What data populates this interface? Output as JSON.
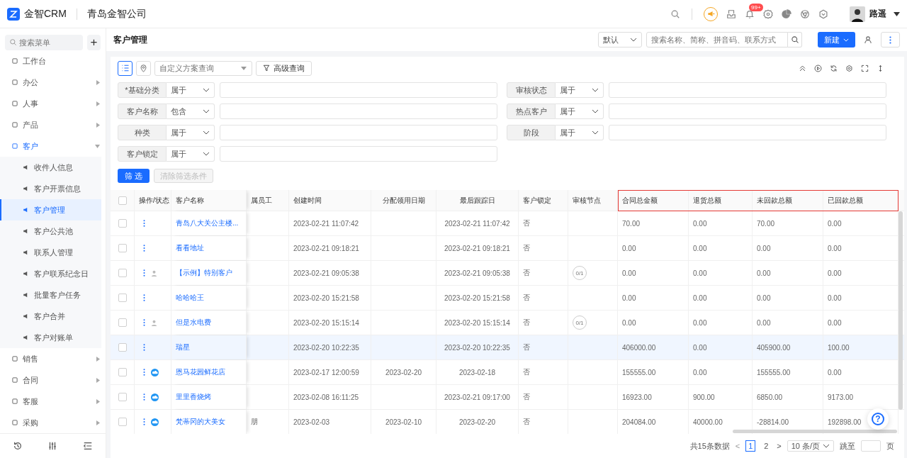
{
  "header": {
    "brand": "金智CRM",
    "company": "青岛金智公司",
    "badge": "99+",
    "user": "路遥"
  },
  "sidebar": {
    "search_placeholder": "搜索菜单",
    "add": "+",
    "items": [
      {
        "label": "工作台",
        "kind": "link",
        "selected": false
      },
      {
        "label": "办公",
        "kind": "group",
        "selected": false,
        "expanded": false
      },
      {
        "label": "人事",
        "kind": "group",
        "selected": false,
        "expanded": false
      },
      {
        "label": "产品",
        "kind": "group",
        "selected": false,
        "expanded": false
      },
      {
        "label": "客户",
        "kind": "group",
        "selected": true,
        "expanded": true,
        "children": [
          {
            "label": "收件人信息",
            "selected": false
          },
          {
            "label": "客户开票信息",
            "selected": false
          },
          {
            "label": "客户管理",
            "selected": true
          },
          {
            "label": "客户公共池",
            "selected": false
          },
          {
            "label": "联系人管理",
            "selected": false
          },
          {
            "label": "客户联系纪念日",
            "selected": false
          },
          {
            "label": "批量客户任务",
            "selected": false
          },
          {
            "label": "客户合并",
            "selected": false
          },
          {
            "label": "客户对账单",
            "selected": false
          }
        ]
      },
      {
        "label": "销售",
        "kind": "group",
        "selected": false,
        "expanded": false
      },
      {
        "label": "合同",
        "kind": "group",
        "selected": false,
        "expanded": false
      },
      {
        "label": "客服",
        "kind": "group",
        "selected": false,
        "expanded": false
      },
      {
        "label": "采购",
        "kind": "group",
        "selected": false,
        "expanded": false
      }
    ]
  },
  "page": {
    "title": "客户管理",
    "scope": "默认",
    "search_placeholder": "搜索名称、简称、拼音码、联系方式",
    "new_button": "新建"
  },
  "toolbar": {
    "scheme_placeholder": "自定义方案查询",
    "advanced": "高级查询",
    "list_view_selected": true
  },
  "filters": [
    {
      "label": "*基础分类",
      "op": "属于"
    },
    {
      "label": "审核状态",
      "op": "属于"
    },
    {
      "label": "客户名称",
      "op": "包含"
    },
    {
      "label": "热点客户",
      "op": "属于"
    },
    {
      "label": "种类",
      "op": "属于"
    },
    {
      "label": "阶段",
      "op": "属于"
    },
    {
      "label": "客户锁定",
      "op": "属于"
    }
  ],
  "filter_buttons": {
    "apply": "筛 选",
    "clear": "清除筛选条件",
    "clear_disabled": true
  },
  "table": {
    "select_all_checked": false,
    "columns": [
      {
        "label": "操作/状态",
        "highlighted": false
      },
      {
        "label": "客户名称",
        "highlighted": false
      },
      {
        "label": "属员工",
        "highlighted": false
      },
      {
        "label": "创建时间",
        "highlighted": false
      },
      {
        "label": "分配领用日期",
        "highlighted": false
      },
      {
        "label": "最后跟踪日",
        "highlighted": false
      },
      {
        "label": "客户锁定",
        "highlighted": false
      },
      {
        "label": "审核节点",
        "highlighted": false
      },
      {
        "label": "合同总金额",
        "highlighted": true
      },
      {
        "label": "退货总额",
        "highlighted": true
      },
      {
        "label": "未回款总额",
        "highlighted": true
      },
      {
        "label": "已回款总额",
        "highlighted": true
      }
    ],
    "rows": [
      {
        "checked": false,
        "highlighted": false,
        "kind": "plain",
        "cells": [
          "",
          "青岛八大关公主楼...",
          "",
          "2023-02-21 11:07:42",
          "",
          "2023-02-21 11:07:42",
          "否",
          "",
          "70.00",
          "0.00",
          "70.00",
          "0.00"
        ]
      },
      {
        "checked": false,
        "highlighted": false,
        "kind": "plain",
        "cells": [
          "",
          "看看地址",
          "",
          "2023-02-21 09:18:21",
          "",
          "2023-02-21 09:18:21",
          "否",
          "",
          "0.00",
          "0.00",
          "0.00",
          "0.00"
        ]
      },
      {
        "checked": false,
        "highlighted": false,
        "kind": "person",
        "cells": [
          "",
          "【示例】特别客户",
          "",
          "2023-02-21 09:05:38",
          "",
          "2023-02-21 09:05:38",
          "否",
          "0/1",
          "0.00",
          "0.00",
          "0.00",
          "0.00"
        ]
      },
      {
        "checked": false,
        "highlighted": false,
        "kind": "plain",
        "cells": [
          "",
          "哈哈哈王",
          "",
          "2023-02-20 15:21:58",
          "",
          "2023-02-20 15:21:58",
          "否",
          "",
          "0.00",
          "0.00",
          "0.00",
          "0.00"
        ]
      },
      {
        "checked": false,
        "highlighted": false,
        "kind": "person",
        "cells": [
          "",
          "但是水电费",
          "",
          "2023-02-20 15:15:14",
          "",
          "2023-02-20 15:15:14",
          "否",
          "0/1",
          "0.00",
          "0.00",
          "0.00",
          "0.00"
        ]
      },
      {
        "checked": false,
        "highlighted": true,
        "kind": "plain",
        "cells": [
          "",
          "瑞星",
          "",
          "2023-02-20 10:22:35",
          "",
          "2023-02-20 10:22:35",
          "否",
          "",
          "406000.00",
          "0.00",
          "405900.00",
          "100.00"
        ]
      },
      {
        "checked": false,
        "highlighted": false,
        "kind": "cloud",
        "cells": [
          "",
          "恩马花园鲜花店",
          "",
          "2023-02-17 12:00:59",
          "2023-02-20",
          "2023-02-18",
          "否",
          "",
          "155555.00",
          "0.00",
          "155555.00",
          "0.00"
        ]
      },
      {
        "checked": false,
        "highlighted": false,
        "kind": "cloud",
        "cells": [
          "",
          "里里香烧烤",
          "",
          "2023-02-08 16:11:25",
          "",
          "2023-02-21 09:17:00",
          "否",
          "",
          "16923.00",
          "900.00",
          "6850.00",
          "9173.00"
        ]
      },
      {
        "checked": false,
        "highlighted": false,
        "kind": "cloud",
        "cells": [
          "",
          "梵蒂冈的大美女",
          "朋",
          "2023-02-03",
          "2023-02-10",
          "2023-02-20",
          "否",
          "",
          "204084.00",
          "40000.00",
          "-28814.00",
          "192898.00"
        ]
      }
    ]
  },
  "pagination": {
    "total": "共15条数据",
    "prev": "<",
    "pages": [
      {
        "label": "1",
        "selected": true
      },
      {
        "label": "2",
        "selected": false
      }
    ],
    "next": ">",
    "page_size": "10 条/页",
    "jump": "跳至",
    "page_unit": "页"
  },
  "help": "?"
}
